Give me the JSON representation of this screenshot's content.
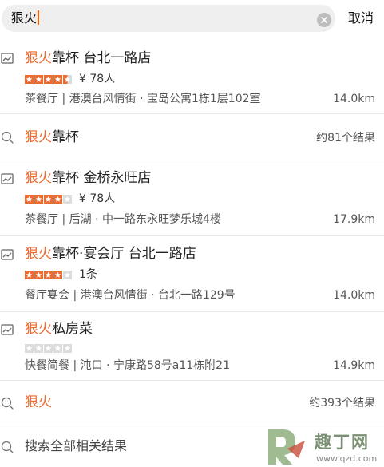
{
  "search": {
    "query": "狠火",
    "cancel_label": "取消"
  },
  "colors": {
    "highlight": "#ee6b2f",
    "star_filled": "#ee6b2f",
    "star_empty": "#dcdcdc",
    "clear_button": "#bdbdbd"
  },
  "results": [
    {
      "type": "shop",
      "icon": "shop-icon",
      "title_highlight": "狠火",
      "title_rest": "靠杯 台北一路店",
      "rating": 4.5,
      "meta": "¥ 78人",
      "address": "茶餐厅 | 港澳台风情街 · 宝岛公寓1栋1层102室",
      "distance": "14.0km"
    },
    {
      "type": "keyword",
      "icon": "search-icon",
      "title_highlight": "狠火",
      "title_rest": "靠杯",
      "count": "约81个结果"
    },
    {
      "type": "shop",
      "icon": "shop-icon",
      "title_highlight": "狠火",
      "title_rest": "靠杯 金桥永旺店",
      "rating": 4,
      "meta": "¥ 78人",
      "address": "茶餐厅 | 后湖 · 中一路东永旺梦乐城4楼",
      "distance": "17.9km"
    },
    {
      "type": "shop",
      "icon": "shop-icon",
      "title_highlight": "狠火",
      "title_rest": "靠杯·宴会厅 台北一路店",
      "rating": 4,
      "meta": "1条",
      "address": "餐厅宴会 | 港澳台风情街 · 台北一路129号",
      "distance": "14.0km"
    },
    {
      "type": "shop",
      "icon": "shop-icon",
      "title_highlight": "狠火",
      "title_rest": "私房菜",
      "rating": 0,
      "meta": "",
      "address": "快餐简餐 | 沌口 · 宁康路58号a11栋附21",
      "distance": "14.9km"
    },
    {
      "type": "keyword",
      "icon": "search-icon",
      "title_highlight": "狠火",
      "title_rest": "",
      "count": "约393个结果"
    },
    {
      "type": "all",
      "icon": "search-icon",
      "label": "搜索全部相关结果"
    }
  ],
  "watermark": {
    "text": "趣丁网",
    "url": "www.qzd.com"
  }
}
